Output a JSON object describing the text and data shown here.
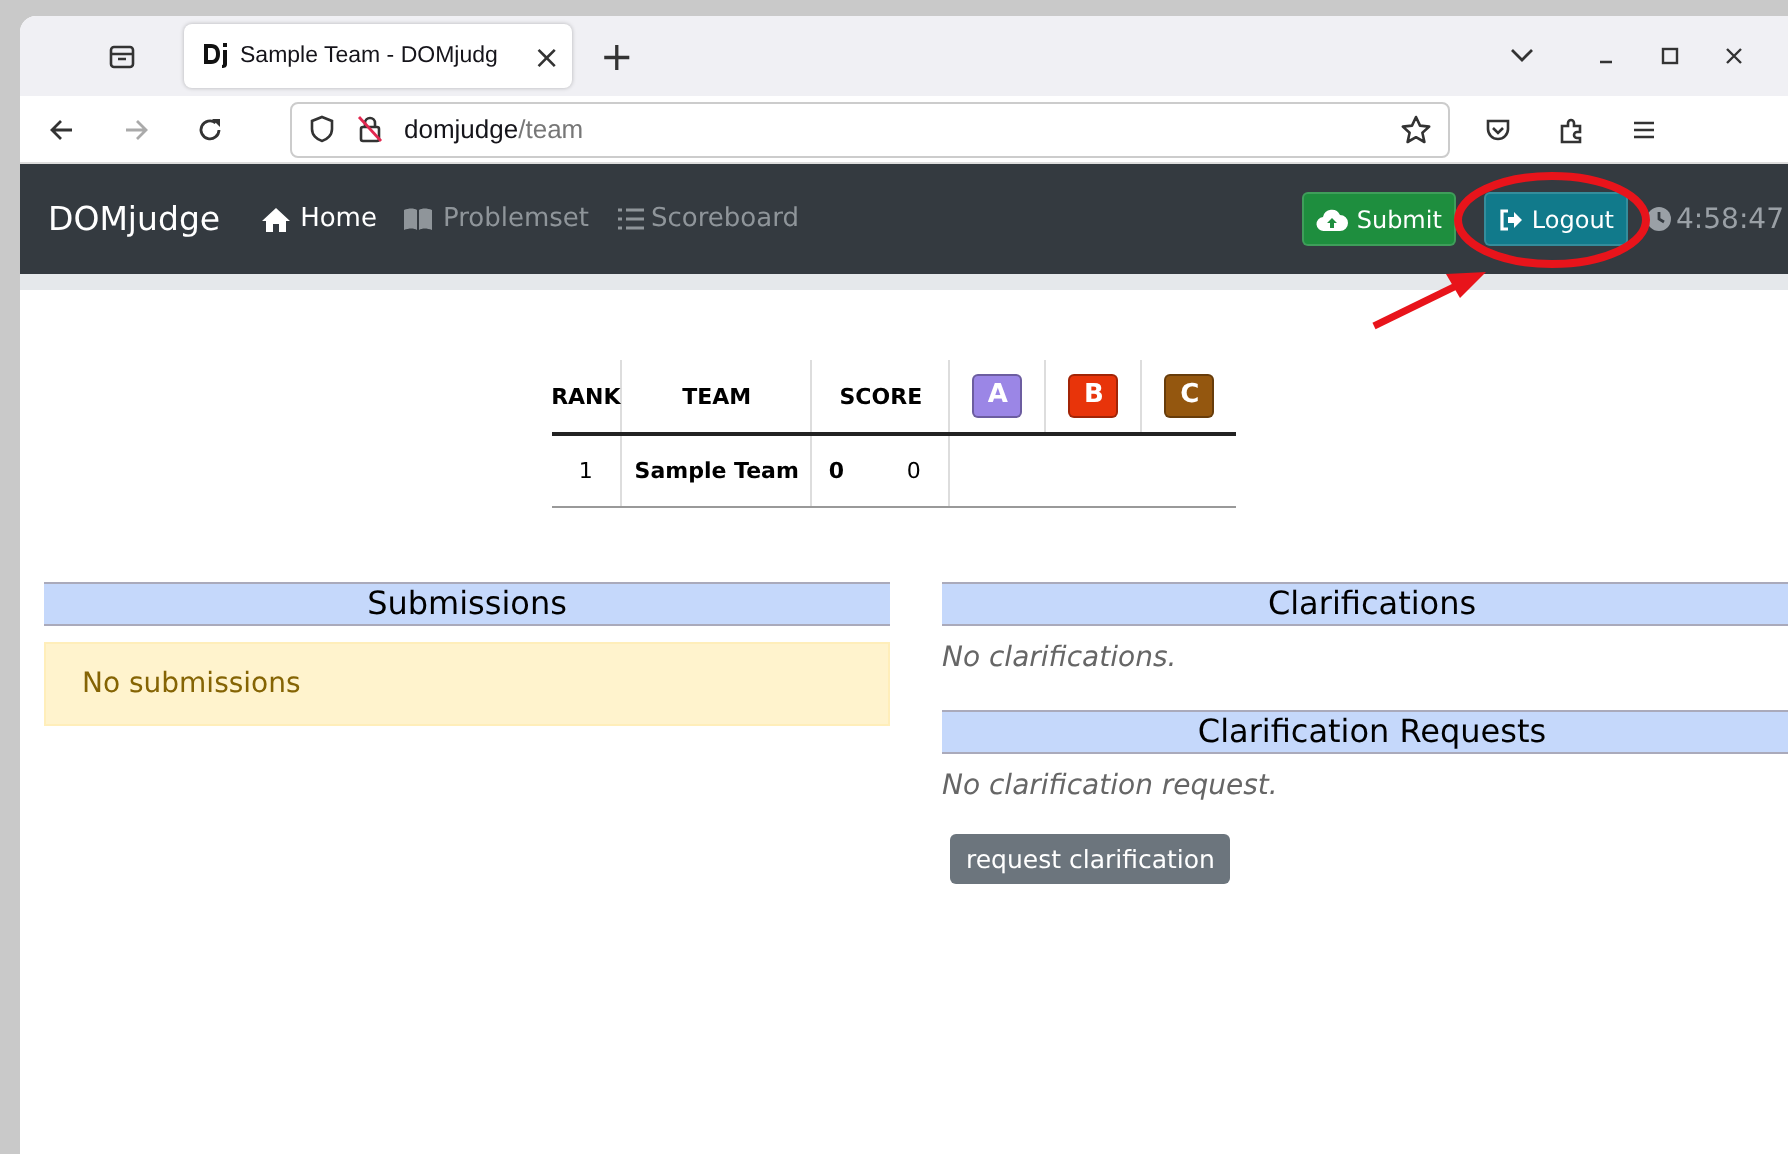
{
  "browser": {
    "tab_title": "Sample Team - DOMjudg",
    "tab_close": "×",
    "new_tab": "+",
    "url_host": "domjudge",
    "url_path": "/team"
  },
  "navbar": {
    "brand": "DOMjudge",
    "items": [
      {
        "label": "Home",
        "selected": true
      },
      {
        "label": "Problemset",
        "selected": false
      },
      {
        "label": "Scoreboard",
        "selected": false
      }
    ],
    "submit": "Submit",
    "logout": "Logout",
    "clock": "4:58:47"
  },
  "scoreboard": {
    "columns": [
      "RANK",
      "TEAM",
      "SCORE"
    ],
    "problems": [
      {
        "label": "A",
        "color": "#9b86e6"
      },
      {
        "label": "B",
        "color": "#e8340a"
      },
      {
        "label": "C",
        "color": "#94570f"
      }
    ],
    "rows": [
      {
        "rank": "1",
        "team": "Sample Team",
        "solved": "0",
        "time": "0"
      }
    ]
  },
  "submissions": {
    "title": "Submissions",
    "empty": "No submissions"
  },
  "clarifications": {
    "title": "Clarifications",
    "empty": "No clarifications."
  },
  "clarification_requests": {
    "title": "Clarification Requests",
    "empty": "No clarification request.",
    "button": "request clarification"
  }
}
